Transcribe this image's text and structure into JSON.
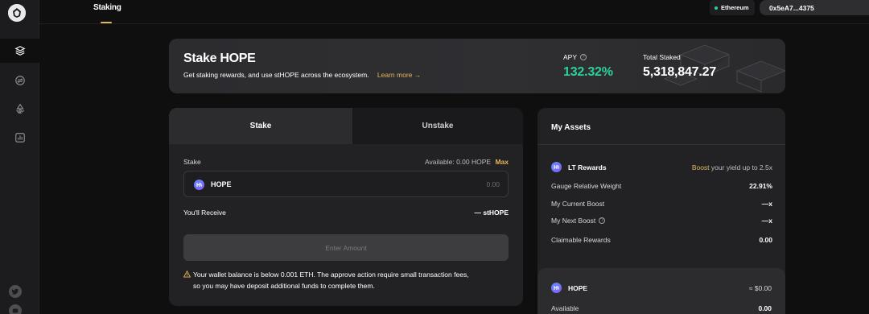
{
  "header": {
    "active_tab": "Staking",
    "network": "Ethereum",
    "wallet_address": "0x5eA7...4375"
  },
  "sidebar": {
    "items": [
      {
        "icon": "layers-icon",
        "active": true
      },
      {
        "icon": "coin-swap-icon",
        "active": false
      },
      {
        "icon": "recycle-icon",
        "active": false
      },
      {
        "icon": "bar-chart-icon",
        "active": false
      }
    ],
    "social": [
      "twitter-icon",
      "discord-icon"
    ]
  },
  "banner": {
    "title": "Stake HOPE",
    "subtitle": "Get staking rewards, and use stHOPE across the ecosystem.",
    "learn_more": "Learn more →",
    "apy_label": "APY",
    "apy_value": "132.32%",
    "total_staked_label": "Total Staked",
    "total_staked_value": "5,318,847.27"
  },
  "stake_panel": {
    "tabs": [
      {
        "label": "Stake",
        "active": true
      },
      {
        "label": "Unstake",
        "active": false
      }
    ],
    "field_label": "Stake",
    "available_text": "Available: 0.00 HOPE",
    "max_label": "Max",
    "token": "HOPE",
    "amount_placeholder": "0.00",
    "receive_label": "You'll Receive",
    "receive_value": "— stHOPE",
    "button_label": "Enter Amount",
    "warning_line1": "Your wallet balance is below 0.001 ETH. The approve action require small transaction fees,",
    "warning_line2": "so you may have deposit additional funds to complete them."
  },
  "assets": {
    "title": "My Assets",
    "lt_title": "LT Rewards",
    "boost_word": "Boost",
    "boost_rest": " your yield up to 2.5x",
    "rows": [
      {
        "label": "Gauge Relative Weight",
        "value": "22.91%"
      },
      {
        "label": "My Current Boost",
        "value": "—x"
      },
      {
        "label": "My Next Boost",
        "value": "—x"
      },
      {
        "label": "Claimable Rewards",
        "value": "0.00"
      }
    ],
    "hope_card": {
      "title": "HOPE",
      "usd_value": "≈ $0.00",
      "available_label": "Available",
      "available_value": "0.00"
    }
  },
  "colors": {
    "accent": "#e4b65c",
    "positive": "#2bd19a",
    "panel": "#222224",
    "background": "#0f0f10"
  }
}
